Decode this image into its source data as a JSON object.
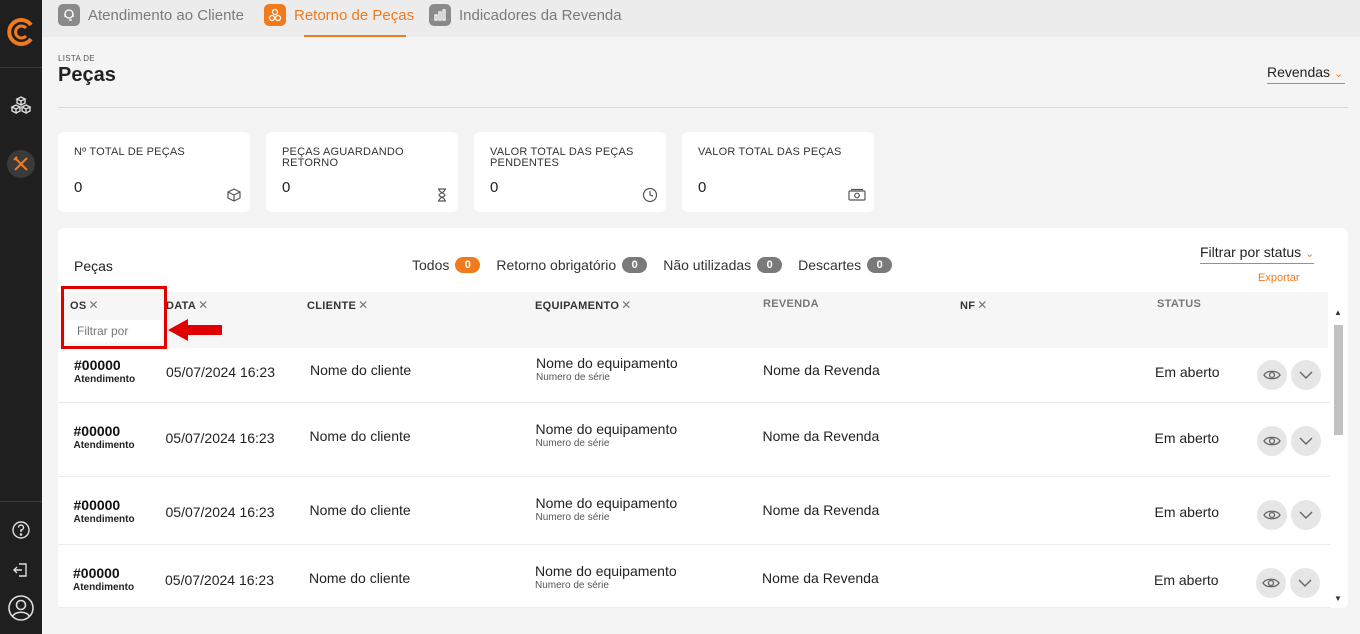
{
  "sidebar": {
    "logo": "company-logo",
    "items": [
      {
        "icon": "cubes-icon",
        "active": false
      },
      {
        "icon": "tools-icon",
        "active": true
      }
    ],
    "bottom": [
      {
        "icon": "help-icon"
      },
      {
        "icon": "logout-icon"
      },
      {
        "icon": "user-icon"
      }
    ]
  },
  "tabs": [
    {
      "label": "Atendimento ao Cliente",
      "icon": "customer-service-icon",
      "active": false
    },
    {
      "label": "Retorno de Peças",
      "icon": "parts-return-icon",
      "active": true
    },
    {
      "label": "Indicadores da Revenda",
      "icon": "chart-bars-icon",
      "active": false
    }
  ],
  "header": {
    "subtitle": "LISTA DE",
    "title": "Peças",
    "revendas_label": "Revendas"
  },
  "cards": [
    {
      "label": "Nº TOTAL DE PEÇAS",
      "value": "0",
      "icon": "box-icon"
    },
    {
      "label": "PEÇAS AGUARDANDO RETORNO",
      "value": "0",
      "icon": "hourglass-icon"
    },
    {
      "label": "VALOR TOTAL DAS PEÇAS PENDENTES",
      "value": "0",
      "icon": "clock-icon"
    },
    {
      "label": "VALOR TOTAL DAS PEÇAS",
      "value": "0",
      "icon": "money-icon"
    }
  ],
  "panel": {
    "title": "Peças",
    "filters": [
      {
        "label": "Todos",
        "count": "0",
        "active": true
      },
      {
        "label": "Retorno obrigatório",
        "count": "0",
        "active": false
      },
      {
        "label": "Não utilizadas",
        "count": "0",
        "active": false
      },
      {
        "label": "Descartes",
        "count": "0",
        "active": false
      }
    ],
    "filter_status_label": "Filtrar por status",
    "export_label": "Exportar"
  },
  "table": {
    "columns": [
      {
        "label": "OS",
        "closable": true
      },
      {
        "label": "DATA",
        "closable": true
      },
      {
        "label": "CLIENTE",
        "closable": true
      },
      {
        "label": "EQUIPAMENTO",
        "closable": true
      },
      {
        "label": "REVENDA",
        "closable": false
      },
      {
        "label": "NF",
        "closable": true
      },
      {
        "label": "STATUS",
        "closable": false
      }
    ],
    "filter_placeholder": "Filtrar por",
    "rows": [
      {
        "os": "#00000",
        "os_type": "Atendimento",
        "date": "05/07/2024 16:23",
        "client": "Nome do cliente",
        "equipment": "Nome do equipamento",
        "serial": "Numero de série",
        "revenda": "Nome da Revenda",
        "status": "Em aberto"
      },
      {
        "os": "#00000",
        "os_type": "Atendimento",
        "date": "05/07/2024 16:23",
        "client": "Nome do cliente",
        "equipment": "Nome do equipamento",
        "serial": "Numero de série",
        "revenda": "Nome da Revenda",
        "status": "Em aberto"
      },
      {
        "os": "#00000",
        "os_type": "Atendimento",
        "date": "05/07/2024 16:23",
        "client": "Nome do cliente",
        "equipment": "Nome do equipamento",
        "serial": "Numero de série",
        "revenda": "Nome da Revenda",
        "status": "Em aberto"
      },
      {
        "os": "#00000",
        "os_type": "Atendimento",
        "date": "05/07/2024 16:23",
        "client": "Nome do cliente",
        "equipment": "Nome do equipamento",
        "serial": "Numero de série",
        "revenda": "Nome da Revenda",
        "status": "Em aberto"
      }
    ]
  },
  "colors": {
    "accent": "#f07a1e",
    "sidebar": "#1f1f1f",
    "highlight": "#e00000"
  }
}
